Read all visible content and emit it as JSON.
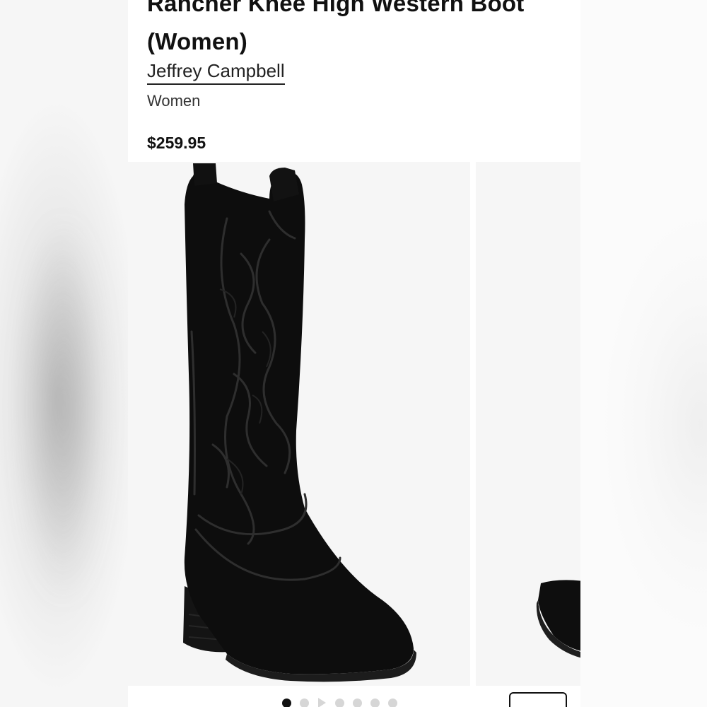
{
  "product": {
    "title_line1": "Rancher Knee High Western Boot",
    "title_line2": "(Women)",
    "brand": "Jeffrey Campbell",
    "category": "Women",
    "price": "$259.95"
  },
  "gallery": {
    "images": [
      {
        "icon": "boot-photo-main"
      },
      {
        "icon": "boot-photo-next"
      }
    ],
    "dots": [
      {
        "type": "dot",
        "active": true
      },
      {
        "type": "dot",
        "active": false
      },
      {
        "type": "play",
        "active": false
      },
      {
        "type": "dot",
        "active": false
      },
      {
        "type": "dot",
        "active": false
      },
      {
        "type": "dot",
        "active": false
      },
      {
        "type": "dot",
        "active": false
      }
    ]
  },
  "colors": {
    "text": "#111111",
    "image_bg": "#f6f6f6",
    "dot_active": "#111111",
    "dot_inactive": "#d6d6d6"
  }
}
